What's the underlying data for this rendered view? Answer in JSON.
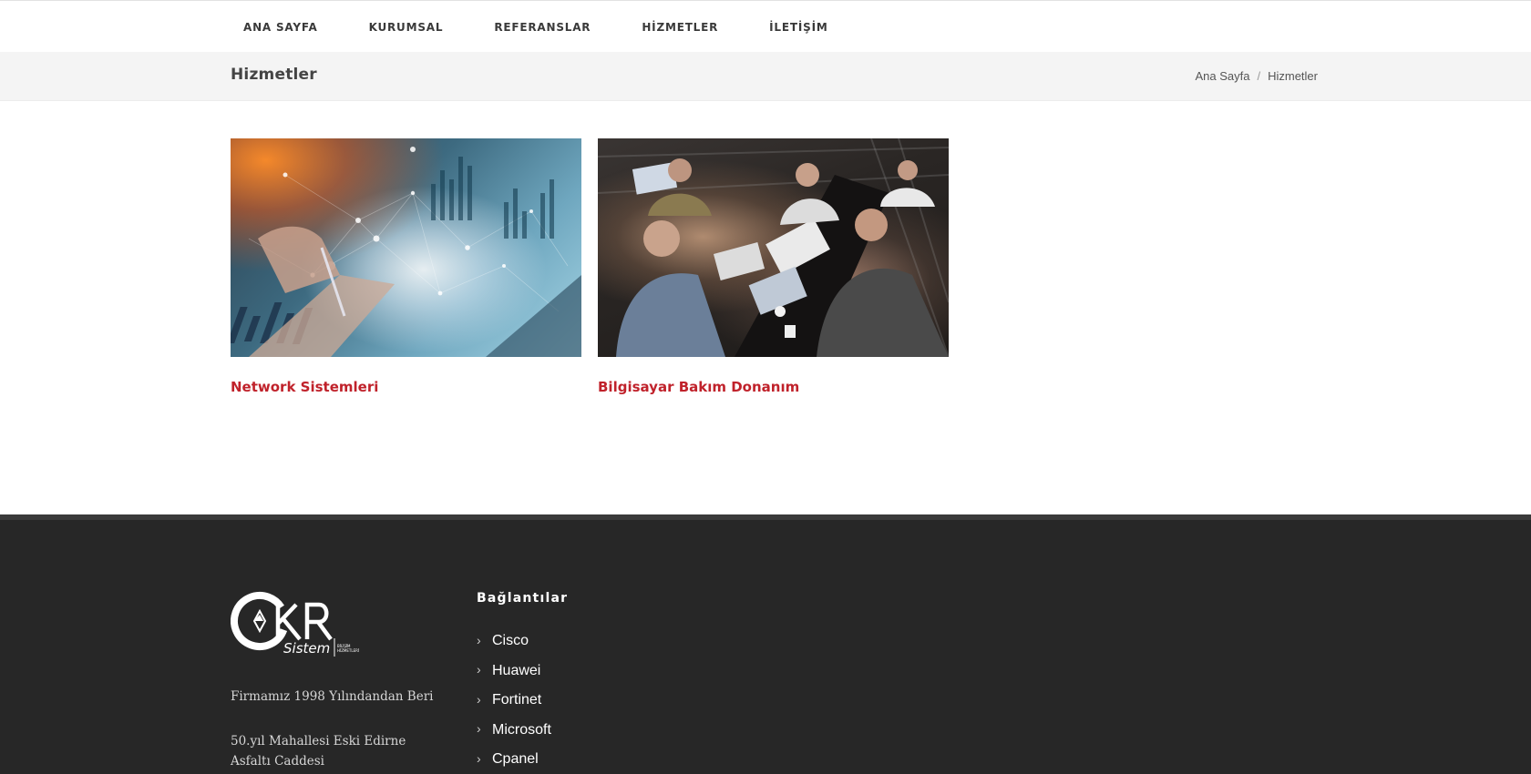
{
  "nav": {
    "items": [
      {
        "label": "ANA SAYFA"
      },
      {
        "label": "KURUMSAL"
      },
      {
        "label": "REFERANSLAR"
      },
      {
        "label": "HİZMETLER"
      },
      {
        "label": "İLETİŞİM"
      }
    ]
  },
  "header": {
    "title": "Hizmetler",
    "breadcrumb": [
      {
        "label": "Ana Sayfa"
      },
      {
        "label": "Hizmetler"
      }
    ],
    "separator": "/"
  },
  "services": [
    {
      "title": "Network Sistemleri",
      "image": "analytics-graph-image"
    },
    {
      "title": "Bilgisayar Bakım Donanım",
      "image": "team-meeting-photo"
    }
  ],
  "footer": {
    "logo_text": "CKR Sistem",
    "logo_subtext": "BİLİŞİM HİZMETLERİ",
    "about": [
      "Firmamız 1998 Yılındandan Beri",
      "50.yıl Mahallesi Eski Edirne Asfaltı Caddesi"
    ],
    "links_title": "Bağlantılar",
    "links": [
      {
        "label": "Cisco"
      },
      {
        "label": "Huawei"
      },
      {
        "label": "Fortinet"
      },
      {
        "label": "Microsoft"
      },
      {
        "label": "Cpanel"
      }
    ]
  },
  "colors": {
    "accent": "#c0222b",
    "footer_bg": "#272727",
    "title_bar_bg": "#f4f4f4"
  }
}
